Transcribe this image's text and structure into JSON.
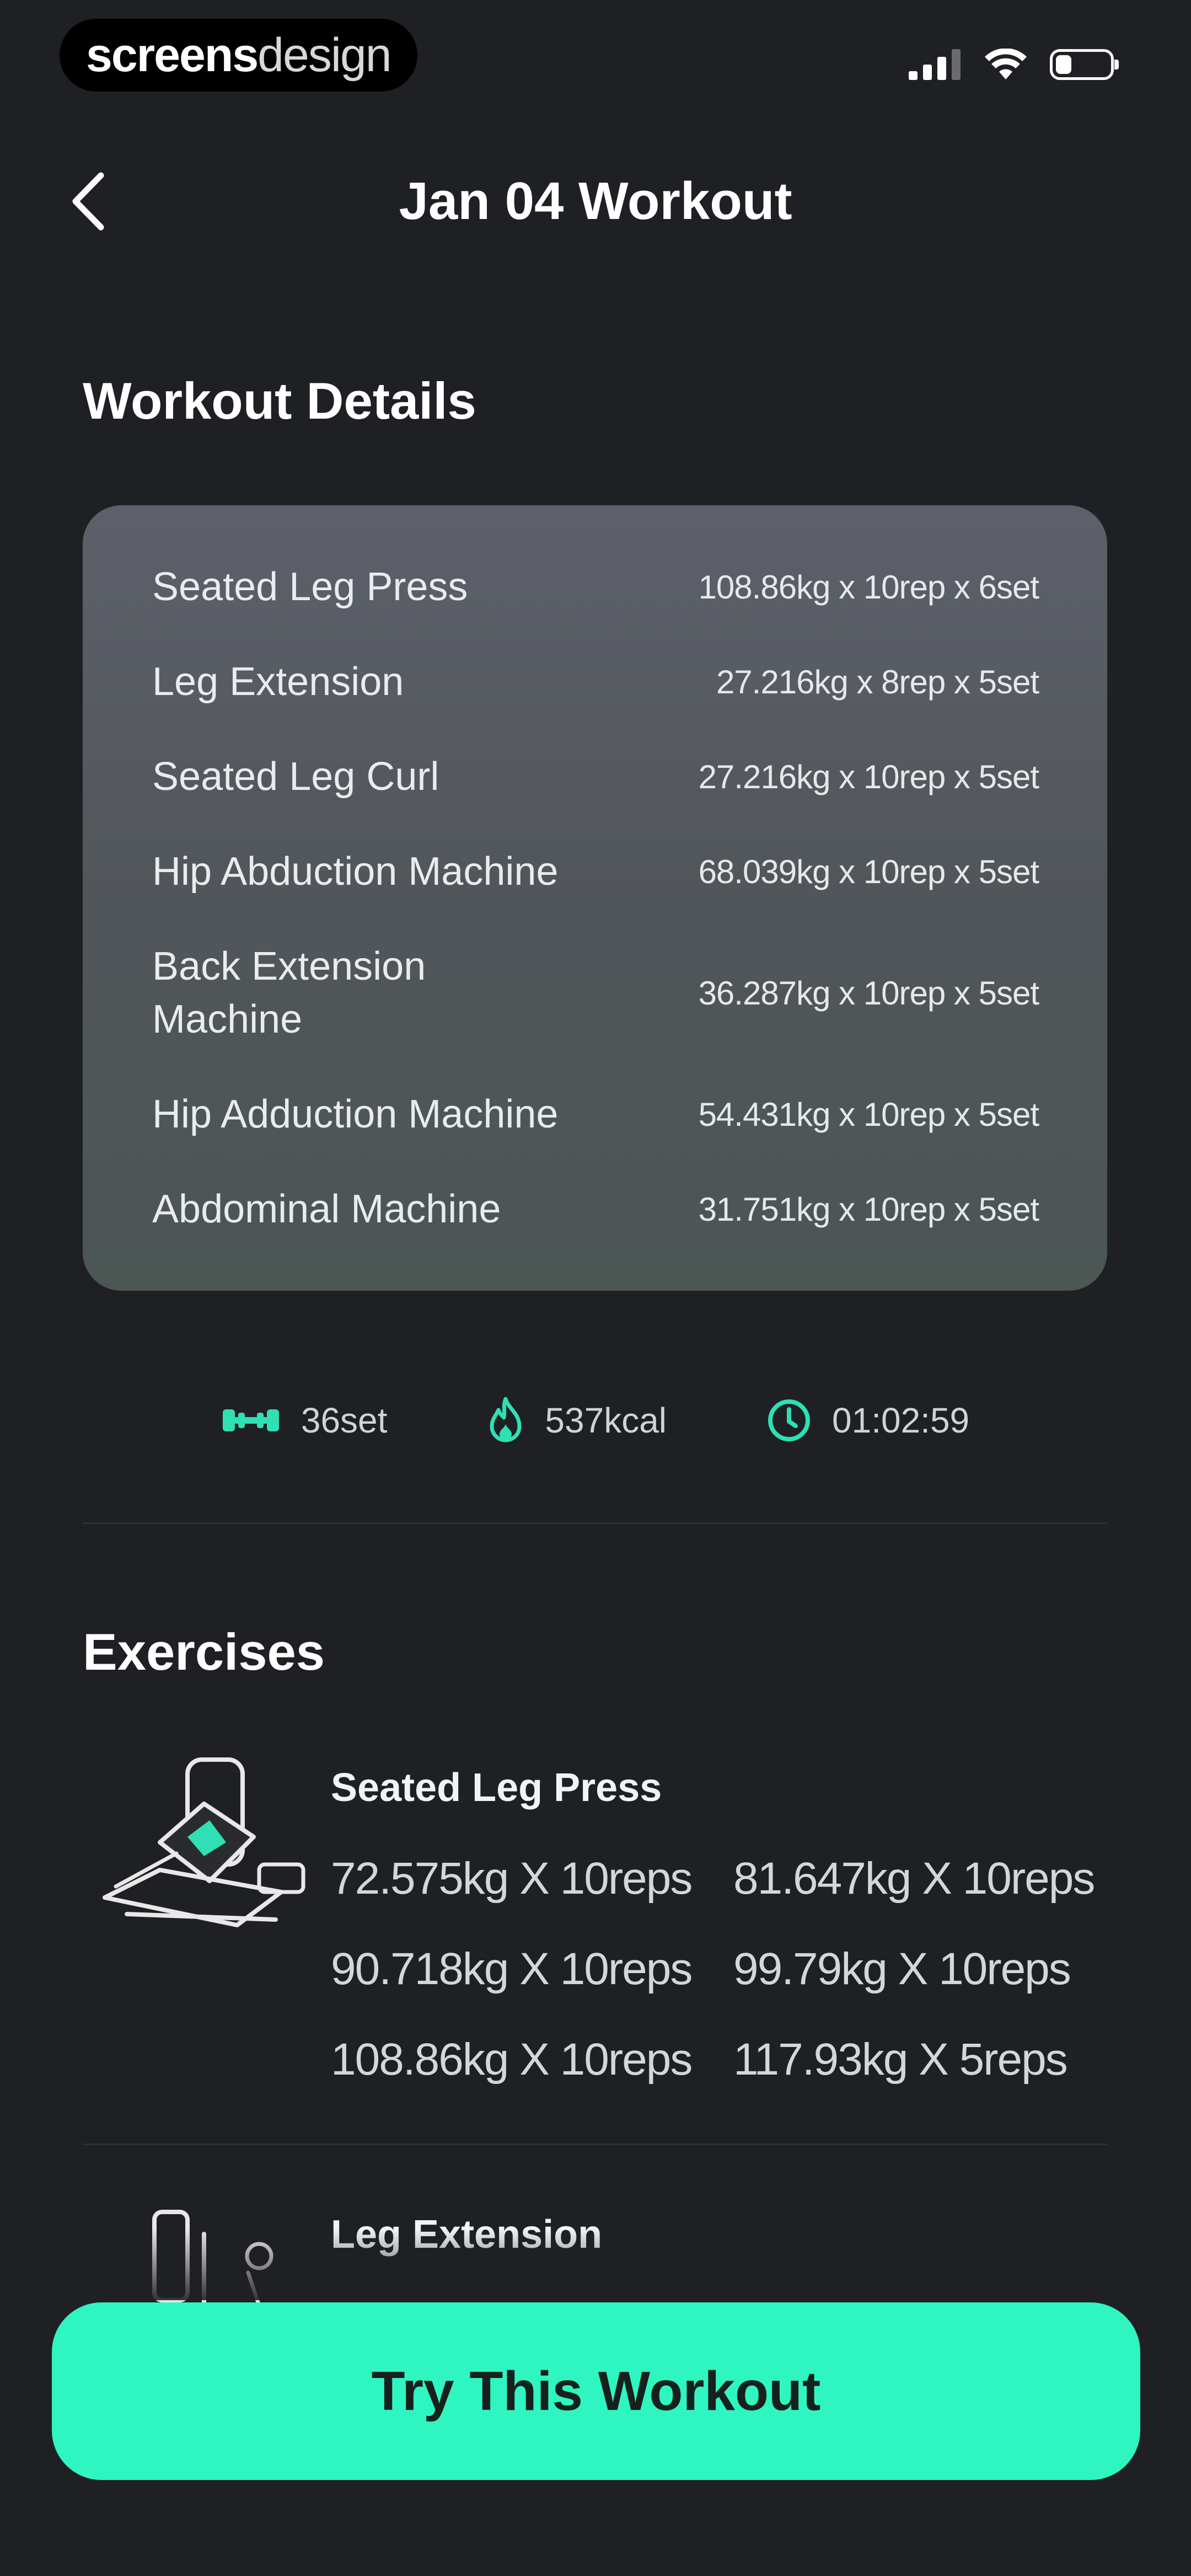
{
  "watermark": {
    "brand_bold": "screens",
    "brand_light": "design"
  },
  "status_bar": {
    "battery_level": 0.3
  },
  "header": {
    "title": "Jan 04 Workout"
  },
  "details": {
    "title": "Workout Details",
    "rows": [
      {
        "name": "Seated Leg Press",
        "value": "108.86kg x 10rep x 6set"
      },
      {
        "name": "Leg Extension",
        "value": "27.216kg x 8rep x 5set"
      },
      {
        "name": "Seated Leg Curl",
        "value": "27.216kg x 10rep x 5set"
      },
      {
        "name": "Hip Abduction Machine",
        "value": "68.039kg x 10rep x 5set"
      },
      {
        "name": "Back Extension Machine",
        "value": "36.287kg x 10rep x 5set"
      },
      {
        "name": "Hip Adduction Machine",
        "value": "54.431kg x 10rep x 5set"
      },
      {
        "name": "Abdominal Machine",
        "value": "31.751kg x 10rep x 5set"
      }
    ]
  },
  "stats": {
    "sets": "36set",
    "calories": "537kcal",
    "duration": "01:02:59"
  },
  "exercises": {
    "title": "Exercises",
    "items": [
      {
        "name": "Seated Leg Press",
        "sets": [
          "72.575kg X 10reps",
          "81.647kg X 10reps",
          "90.718kg X 10reps",
          "99.79kg X 10reps",
          "108.86kg X 10reps",
          "117.93kg X 5reps"
        ]
      },
      {
        "name": "Leg Extension"
      }
    ]
  },
  "cta": {
    "label": "Try This Workout"
  },
  "colors": {
    "background": "#1f2024",
    "accent": "#2ff5c1",
    "card_top": "#5d6069",
    "card_bottom": "#4c5653",
    "icon_accent": "#2ee0b3"
  }
}
